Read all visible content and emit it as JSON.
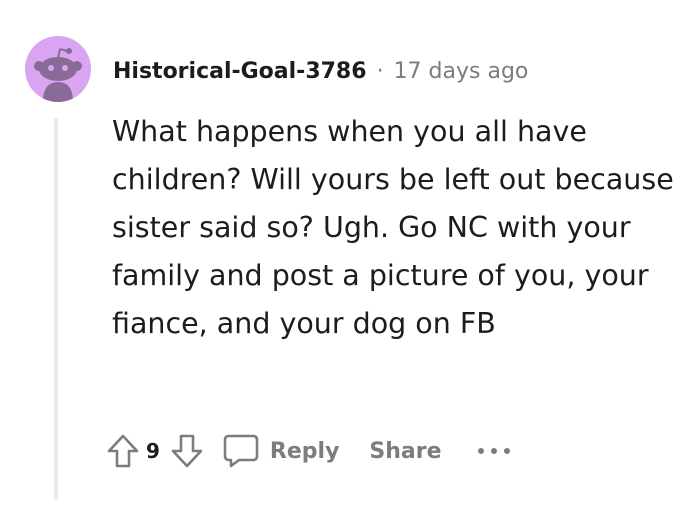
{
  "comment": {
    "author": "Historical-Goal-3786",
    "separator": "·",
    "timestamp": "17 days ago",
    "body": "What happens when you all have children? Will yours be left out because sister said so? Ugh. Go NC with your family and post a picture of you, your fiance, and your dog on FB",
    "avatar_color": "#d9a5f2"
  },
  "actions": {
    "upvote_icon": "arrow-up-icon",
    "score": "9",
    "downvote_icon": "arrow-down-icon",
    "reply_icon": "speech-bubble-icon",
    "reply_label": "Reply",
    "share_label": "Share",
    "more_icon": "ellipsis-icon"
  }
}
